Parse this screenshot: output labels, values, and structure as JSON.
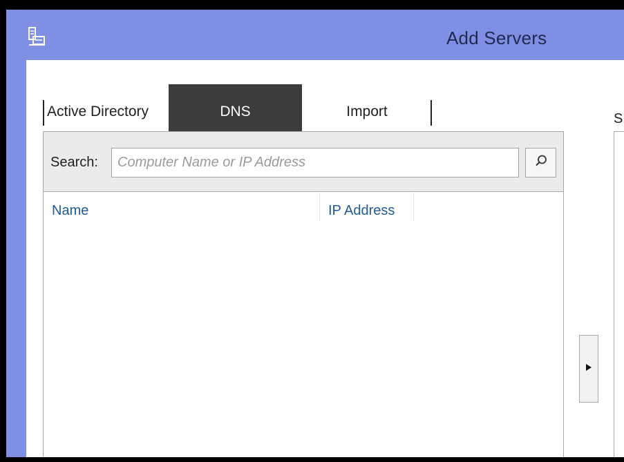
{
  "window": {
    "title": "Add Servers",
    "accent_color": "#7e8fe4"
  },
  "tabs": [
    {
      "label": "Active Directory",
      "active": false
    },
    {
      "label": "DNS",
      "active": true
    },
    {
      "label": "Import",
      "active": false
    }
  ],
  "search": {
    "label": "Search:",
    "placeholder": "Computer Name or IP Address",
    "value": "",
    "button_icon": "search-icon"
  },
  "results": {
    "columns": [
      "Name",
      "IP Address"
    ],
    "rows": []
  },
  "move_button": {
    "icon": "right-triangle-icon",
    "glyph": "▶"
  },
  "right_panel": {
    "header_fragment": "S"
  }
}
